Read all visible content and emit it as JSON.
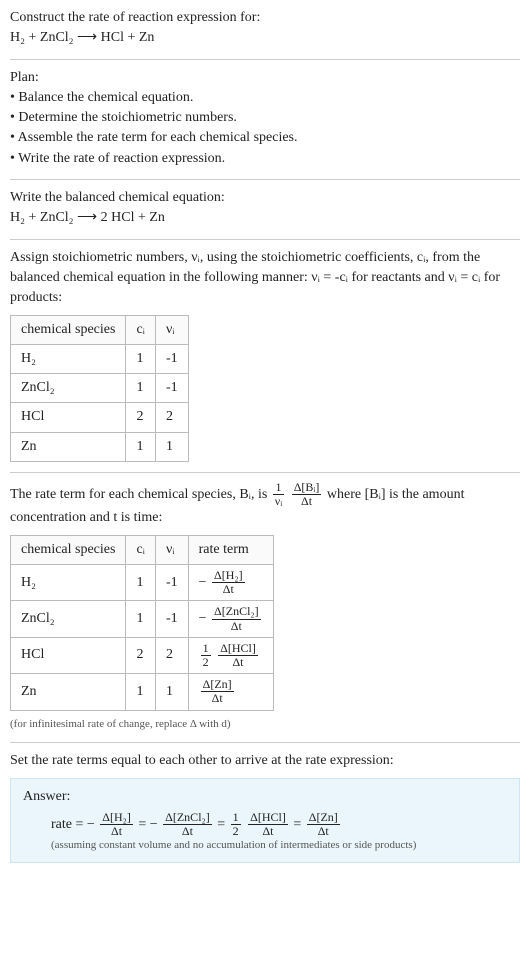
{
  "intro": {
    "line1": "Construct the rate of reaction expression for:",
    "equation": "H₂ + ZnCl₂ ⟶ HCl + Zn"
  },
  "plan": {
    "heading": "Plan:",
    "items": [
      "• Balance the chemical equation.",
      "• Determine the stoichiometric numbers.",
      "• Assemble the rate term for each chemical species.",
      "• Write the rate of reaction expression."
    ]
  },
  "balanced": {
    "heading": "Write the balanced chemical equation:",
    "equation": "H₂ + ZnCl₂ ⟶ 2 HCl + Zn"
  },
  "assign": {
    "text": "Assign stoichiometric numbers, νᵢ, using the stoichiometric coefficients, cᵢ, from the balanced chemical equation in the following manner: νᵢ = -cᵢ for reactants and νᵢ = cᵢ for products:",
    "headers": [
      "chemical species",
      "cᵢ",
      "νᵢ"
    ],
    "rows": [
      [
        "H₂",
        "1",
        "-1"
      ],
      [
        "ZnCl₂",
        "1",
        "-1"
      ],
      [
        "HCl",
        "2",
        "2"
      ],
      [
        "Zn",
        "1",
        "1"
      ]
    ]
  },
  "rateterm": {
    "pre": "The rate term for each chemical species, Bᵢ, is ",
    "frac1_num": "1",
    "frac1_den": "νᵢ",
    "frac2_num": "Δ[Bᵢ]",
    "frac2_den": "Δt",
    "post": " where [Bᵢ] is the amount concentration and t is time:",
    "headers": [
      "chemical species",
      "cᵢ",
      "νᵢ",
      "rate term"
    ],
    "rows": [
      {
        "sp": "H₂",
        "c": "1",
        "v": "-1",
        "neg": "−",
        "coef_num": "",
        "coef_den": "",
        "num": "Δ[H₂]",
        "den": "Δt"
      },
      {
        "sp": "ZnCl₂",
        "c": "1",
        "v": "-1",
        "neg": "−",
        "coef_num": "",
        "coef_den": "",
        "num": "Δ[ZnCl₂]",
        "den": "Δt"
      },
      {
        "sp": "HCl",
        "c": "2",
        "v": "2",
        "neg": "",
        "coef_num": "1",
        "coef_den": "2",
        "num": "Δ[HCl]",
        "den": "Δt"
      },
      {
        "sp": "Zn",
        "c": "1",
        "v": "1",
        "neg": "",
        "coef_num": "",
        "coef_den": "",
        "num": "Δ[Zn]",
        "den": "Δt"
      }
    ],
    "note": "(for infinitesimal rate of change, replace Δ with d)"
  },
  "final": {
    "heading": "Set the rate terms equal to each other to arrive at the rate expression:",
    "answer_label": "Answer:",
    "rate_prefix": "rate = −",
    "t1_num": "Δ[H₂]",
    "t1_den": "Δt",
    "eq1": " = −",
    "t2_num": "Δ[ZnCl₂]",
    "t2_den": "Δt",
    "eq2": " = ",
    "coef_num": "1",
    "coef_den": "2",
    "t3_num": "Δ[HCl]",
    "t3_den": "Δt",
    "eq3": " = ",
    "t4_num": "Δ[Zn]",
    "t4_den": "Δt",
    "assumption": "(assuming constant volume and no accumulation of intermediates or side products)"
  }
}
